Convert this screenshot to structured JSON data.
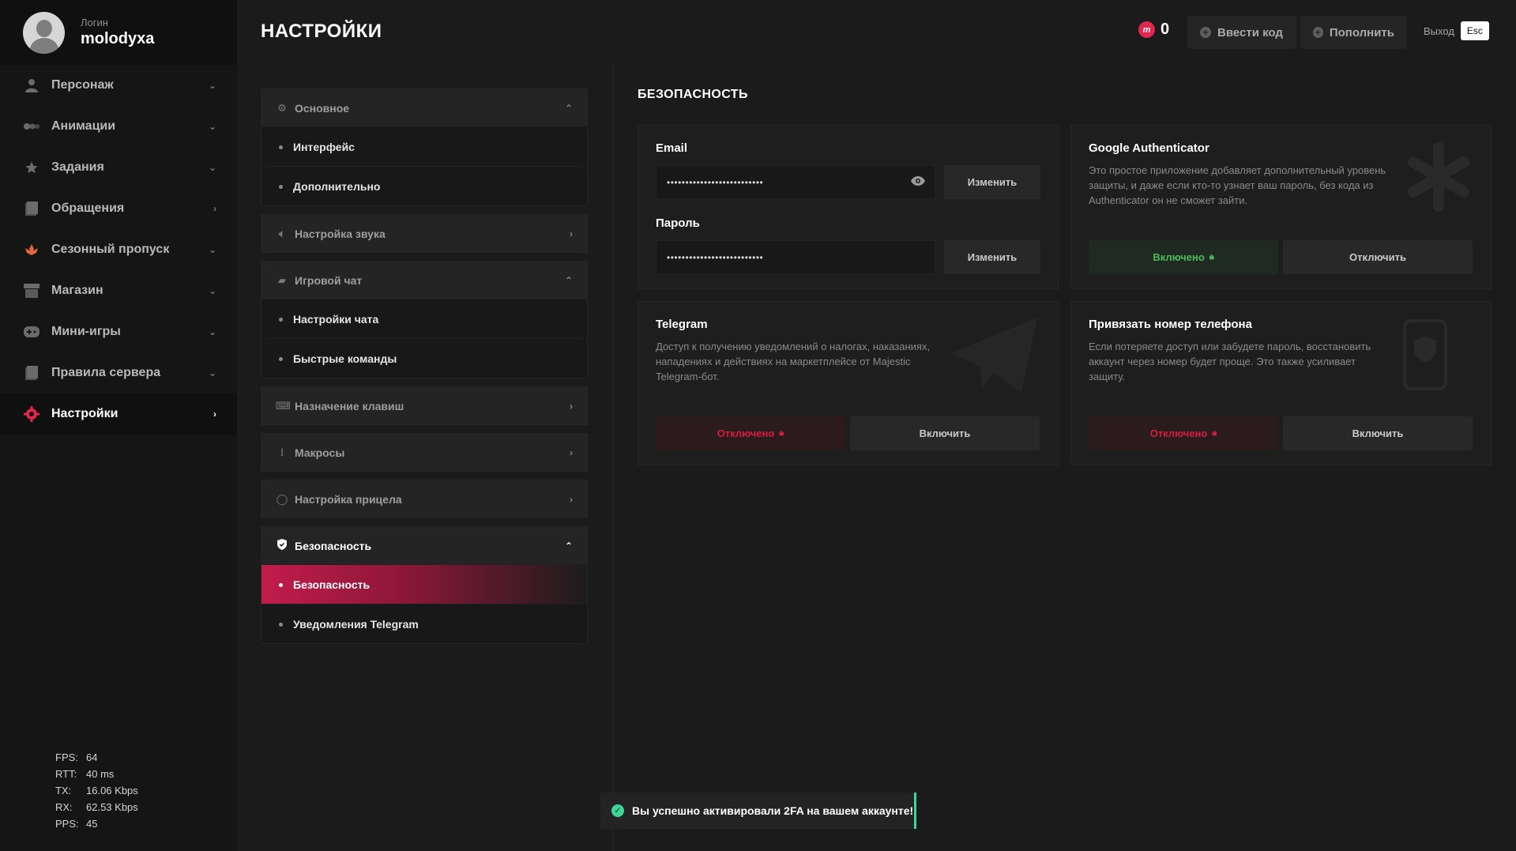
{
  "profile": {
    "label": "Логин",
    "username": "molodyxa"
  },
  "sidebar": {
    "items": [
      {
        "label": "Персонаж",
        "icon": "person-icon",
        "arrow": "⌄"
      },
      {
        "label": "Анимации",
        "icon": "animations-icon",
        "arrow": "⌄"
      },
      {
        "label": "Задания",
        "icon": "star-icon",
        "arrow": "⌄"
      },
      {
        "label": "Обращения",
        "icon": "document-icon",
        "arrow": "›"
      },
      {
        "label": "Сезонный пропуск",
        "icon": "season-pass-icon",
        "arrow": "⌄"
      },
      {
        "label": "Магазин",
        "icon": "shop-icon",
        "arrow": "⌄"
      },
      {
        "label": "Мини-игры",
        "icon": "gamepad-icon",
        "arrow": "⌄"
      },
      {
        "label": "Правила сервера",
        "icon": "rules-icon",
        "arrow": "⌄"
      },
      {
        "label": "Настройки",
        "icon": "settings-gear-icon",
        "arrow": "›",
        "active": true
      }
    ]
  },
  "stats": [
    {
      "k": "FPS:",
      "v": "64"
    },
    {
      "k": "RTT:",
      "v": "40 ms"
    },
    {
      "k": "TX:",
      "v": "16.06 Kbps"
    },
    {
      "k": "RX:",
      "v": "62.53 Kbps"
    },
    {
      "k": "PPS:",
      "v": "45"
    }
  ],
  "header": {
    "title": "НАСТРОЙКИ",
    "balance": "0",
    "coin_symbol": "m",
    "enter_code": "Ввести код",
    "top_up": "Пополнить",
    "exit": "Выход",
    "exit_key": "Esc"
  },
  "menu": {
    "groups": [
      {
        "label": "Основное",
        "icon": "gear-icon",
        "arrow": "⌃",
        "subs": [
          "Интерфейс",
          "Дополнительно"
        ]
      },
      {
        "label": "Настройка звука",
        "icon": "speaker-icon",
        "arrow": "›",
        "subs": []
      },
      {
        "label": "Игровой чат",
        "icon": "chat-icon",
        "arrow": "⌃",
        "subs": [
          "Настройки чата",
          "Быстрые команды"
        ]
      },
      {
        "label": "Назначение клавиш",
        "icon": "keyboard-icon",
        "arrow": "›",
        "subs": []
      },
      {
        "label": "Макросы",
        "icon": "macros-icon",
        "arrow": "›",
        "subs": []
      },
      {
        "label": "Настройка прицела",
        "icon": "crosshair-icon",
        "arrow": "›",
        "subs": []
      },
      {
        "label": "Безопасность",
        "icon": "shield-icon",
        "arrow": "⌃",
        "active": true,
        "subs": [
          "Безопасность",
          "Уведомления Telegram"
        ]
      }
    ]
  },
  "content": {
    "section_title": "БЕЗОПАСНОСТЬ",
    "account": {
      "email_label": "Email",
      "email_value": "••••••••••••••••••••••••••",
      "password_label": "Пароль",
      "password_value": "••••••••••••••••••••••••••",
      "change": "Изменить"
    },
    "google": {
      "title": "Google Authenticator",
      "desc": "Это простое приложение добавляет дополнительный уровень защиты, и даже если кто-то узнает ваш пароль, без кода из Authenticator он не сможет зайти.",
      "status": "Включено",
      "action": "Отключить"
    },
    "telegram": {
      "title": "Telegram",
      "desc": "Доступ к получению уведомлений о налогах, наказаниях, нападениях и действиях на маркетплейсе от Majestic Telegram-бот.",
      "status": "Отключено",
      "action": "Включить"
    },
    "phone": {
      "title": "Привязать номер телефона",
      "desc": "Если потеряете доступ или забудете пароль, восстановить аккаунт через номер будет проще. Это также усиливает защиту.",
      "status": "Отключено",
      "action": "Включить"
    }
  },
  "toast": {
    "text": "Вы успешно активировали 2FA на вашем аккаунте!"
  },
  "colors": {
    "accent": "#e0284f",
    "success": "#4dbb5a",
    "danger": "#d31f40",
    "toast": "#3fd49a"
  }
}
